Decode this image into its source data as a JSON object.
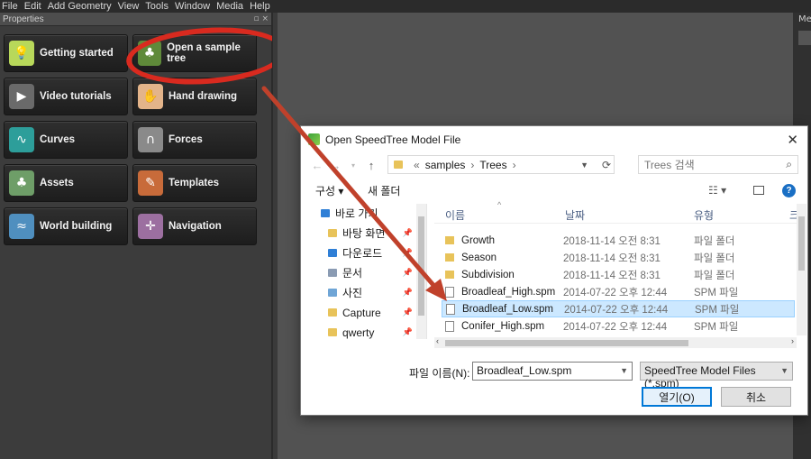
{
  "menu": [
    "File",
    "Edit",
    "Add Geometry",
    "View",
    "Tools",
    "Window",
    "Media",
    "Help"
  ],
  "panel": {
    "title": "Properties",
    "controls": "▫ ×",
    "tiles": [
      {
        "label": "Getting started",
        "icon": "lightbulb-icon",
        "color": "#b8d85a"
      },
      {
        "label": "Open a sample tree",
        "icon": "tree-icon",
        "color": "#5f8a3a"
      },
      {
        "label": "Video tutorials",
        "icon": "play-icon",
        "color": "#6a6a6a"
      },
      {
        "label": "Hand drawing",
        "icon": "hand-icon",
        "color": "#e3b48a"
      },
      {
        "label": "Curves",
        "icon": "curve-icon",
        "color": "#2d9e9a"
      },
      {
        "label": "Forces",
        "icon": "magnet-icon",
        "color": "#8a8a8a"
      },
      {
        "label": "Assets",
        "icon": "tree-globe-icon",
        "color": "#6e9e68"
      },
      {
        "label": "Templates",
        "icon": "wrench-icon",
        "color": "#c86b3a"
      },
      {
        "label": "World building",
        "icon": "landscape-icon",
        "color": "#4f8fbf"
      },
      {
        "label": "Navigation",
        "icon": "axes-icon",
        "color": "#9c6fa0"
      }
    ]
  },
  "right_panel": {
    "label": "Me"
  },
  "dialog": {
    "title": "Open SpeedTree Model File",
    "close": "✕",
    "breadcrumb": [
      "«",
      "samples",
      "›",
      "Trees",
      "›"
    ],
    "search_placeholder": "Trees 검색",
    "organize": "구성 ▾",
    "new_folder": "새 폴더",
    "nav_items": [
      {
        "label": "바로 가기",
        "icon": "star-icon",
        "color": "#2f7fd6",
        "pinned": false
      },
      {
        "label": "바탕 화면",
        "icon": "folder-icon",
        "color": "#e8c35a",
        "pinned": true
      },
      {
        "label": "다운로드",
        "icon": "download-icon",
        "color": "#2f7fd6",
        "pinned": true
      },
      {
        "label": "문서",
        "icon": "document-icon",
        "color": "#8a9bb3",
        "pinned": true
      },
      {
        "label": "사진",
        "icon": "picture-icon",
        "color": "#6fa5d6",
        "pinned": true
      },
      {
        "label": "Capture",
        "icon": "folder-icon",
        "color": "#e8c35a",
        "pinned": true
      },
      {
        "label": "qwerty",
        "icon": "folder-icon",
        "color": "#e8c35a",
        "pinned": true
      }
    ],
    "columns": [
      "이름",
      "날짜",
      "유형",
      "크"
    ],
    "files": [
      {
        "name": "Growth",
        "date": "2018-11-14 오전 8:31",
        "type": "파일 폴더",
        "kind": "folder"
      },
      {
        "name": "Season",
        "date": "2018-11-14 오전 8:31",
        "type": "파일 폴더",
        "kind": "folder"
      },
      {
        "name": "Subdivision",
        "date": "2018-11-14 오전 8:31",
        "type": "파일 폴더",
        "kind": "folder"
      },
      {
        "name": "Broadleaf_High.spm",
        "date": "2014-07-22 오후 12:44",
        "type": "SPM 파일",
        "kind": "file"
      },
      {
        "name": "Broadleaf_Low.spm",
        "date": "2014-07-22 오후 12:44",
        "type": "SPM 파일",
        "kind": "file",
        "selected": true
      },
      {
        "name": "Conifer_High.spm",
        "date": "2014-07-22 오후 12:44",
        "type": "SPM 파일",
        "kind": "file"
      }
    ],
    "filename_label": "파일 이름(N):",
    "filename_value": "Broadleaf_Low.spm",
    "filetype_value": "SpeedTree Model Files (*.spm)",
    "open_label": "열기(O)",
    "cancel_label": "취소"
  },
  "colors": {
    "highlight_ring": "#d92a1f",
    "arrow": "#c0412b",
    "selection": "#cce8ff"
  }
}
